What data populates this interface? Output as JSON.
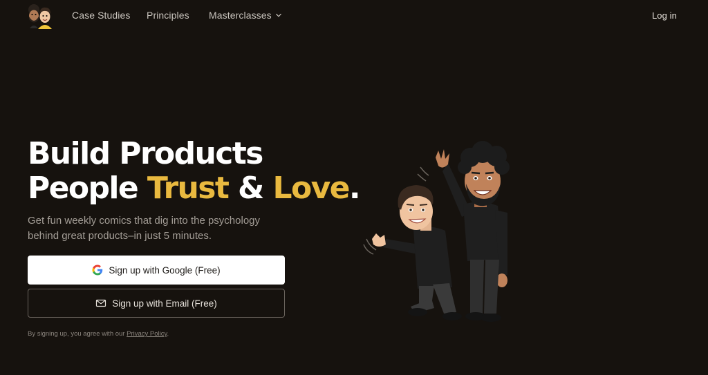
{
  "nav": {
    "links": [
      "Case Studies",
      "Principles",
      "Masterclasses"
    ],
    "login": "Log in"
  },
  "hero": {
    "title_line1": "Build Products",
    "title_line2_part1": "People ",
    "title_line2_accent1": "Trust",
    "title_line2_part2": " & ",
    "title_line2_accent2": "Love",
    "title_line2_part3": ".",
    "subtitle": "Get fun weekly comics that dig into the psychology behind great products–in just 5 minutes.",
    "google_button": "Sign up with Google (Free)",
    "email_button": "Sign up with Email (Free)",
    "disclaimer_text": "By signing up, you agree with our ",
    "disclaimer_link": "Privacy Policy",
    "disclaimer_end": "."
  },
  "colors": {
    "background": "#16120e",
    "accent": "#e9b93f",
    "subtext": "#a39d96"
  },
  "icons": {
    "logo": "two-avatars-logo",
    "chevron": "chevron-down-icon",
    "google": "google-g-icon",
    "email": "envelope-icon"
  }
}
